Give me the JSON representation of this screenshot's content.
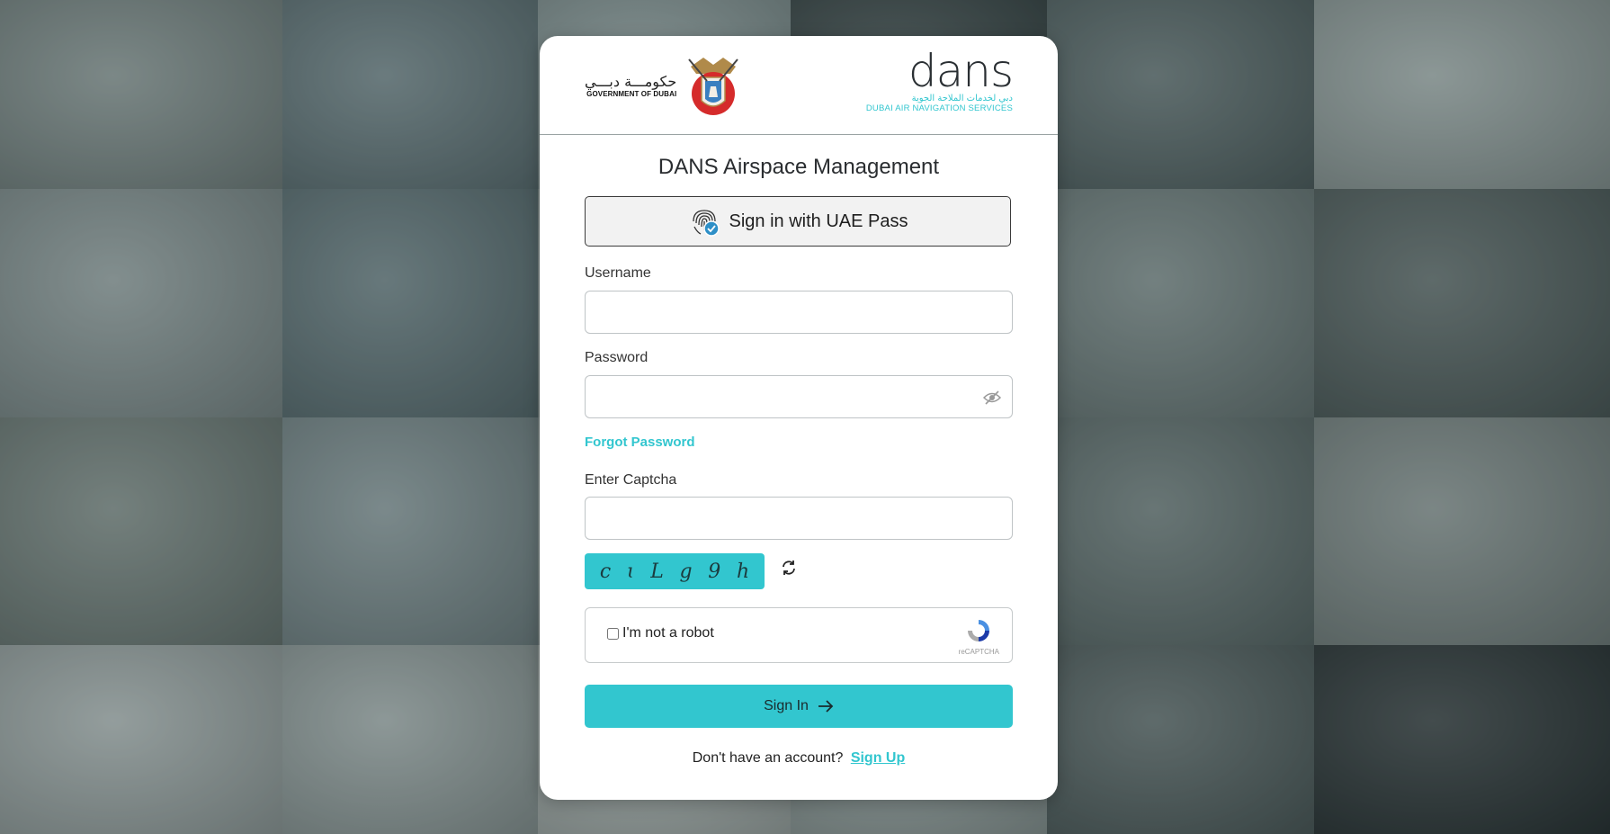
{
  "header": {
    "gov_logo_ar": "حكومـــة دبـــي",
    "gov_logo_en": "GOVERNMENT OF DUBAI",
    "dans_logo": "dans",
    "dans_tagline_ar": "دبي لخدمات الملاحة الجوية",
    "dans_tagline_en": "DUBAI AIR NAVIGATION SERVICES"
  },
  "title": "DANS Airspace Management",
  "uae_pass_label": "Sign in with UAE Pass",
  "form": {
    "username_label": "Username",
    "username_value": "",
    "password_label": "Password",
    "password_value": "",
    "forgot_password": "Forgot Password",
    "captcha_label": "Enter Captcha",
    "captcha_value": "",
    "captcha_chars": [
      "c",
      "ɩ",
      "L",
      "g",
      "9",
      "h"
    ],
    "recaptcha_label": "I'm not a robot",
    "recaptcha_brand": "reCAPTCHA",
    "submit_label": "Sign In",
    "signup_prompt": "Don't have an account?",
    "signup_link": "Sign Up"
  },
  "colors": {
    "accent": "#32c6cf",
    "text": "#2a2d30",
    "card": "#ffffff"
  },
  "icons": [
    "fingerprint-check-icon",
    "eye-slash-icon",
    "refresh-icon",
    "arrow-right-icon",
    "recaptcha-logo-icon"
  ]
}
